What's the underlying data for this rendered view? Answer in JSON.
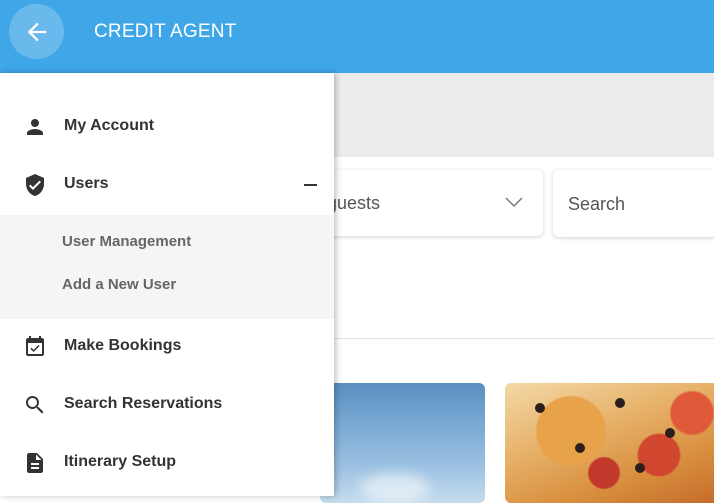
{
  "app": {
    "title": "CREDIT AGENT",
    "accent": "#3fa6e8"
  },
  "drawer": {
    "items": [
      {
        "label": "My Account",
        "icon": "person-icon"
      },
      {
        "label": "Users",
        "icon": "shield-check-icon",
        "expanded": true,
        "children": [
          {
            "label": "User Management"
          },
          {
            "label": "Add a New User"
          }
        ]
      },
      {
        "label": "Make Bookings",
        "icon": "calendar-check-icon"
      },
      {
        "label": "Search Reservations",
        "icon": "search-icon"
      },
      {
        "label": "Itinerary Setup",
        "icon": "document-icon"
      }
    ]
  },
  "filters": {
    "guests_label": "guests",
    "search_placeholder": "Search"
  }
}
